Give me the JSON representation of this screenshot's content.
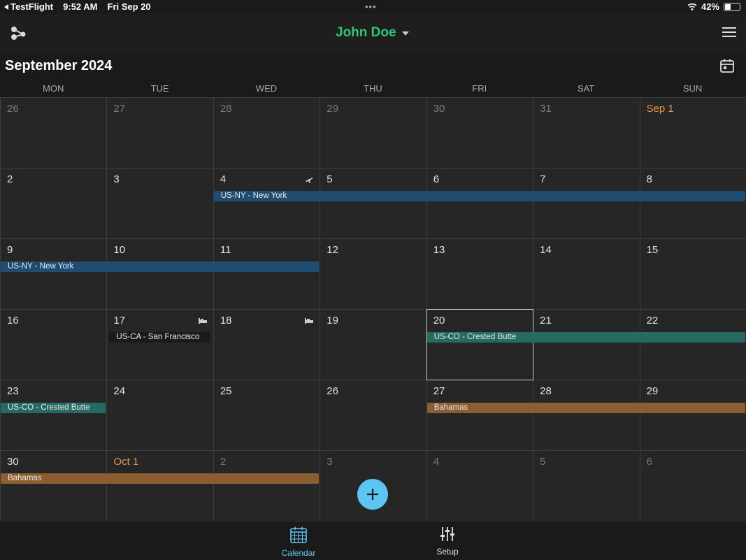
{
  "status_bar": {
    "back_app": "TestFlight",
    "time": "9:52 AM",
    "date": "Fri Sep 20",
    "dots": "•••",
    "battery": "42%",
    "battery_level": 0.42
  },
  "header": {
    "user": "John Doe",
    "title_color": "#2fc57b"
  },
  "calendar": {
    "month_title": "September 2024",
    "weekdays": [
      "MON",
      "TUE",
      "WED",
      "THU",
      "FRI",
      "SAT",
      "SUN"
    ],
    "weeks": [
      [
        "26",
        "27",
        "28",
        "29",
        "30",
        "31",
        "Sep 1"
      ],
      [
        "2",
        "3",
        "4",
        "5",
        "6",
        "7",
        "8"
      ],
      [
        "9",
        "10",
        "11",
        "12",
        "13",
        "14",
        "15"
      ],
      [
        "16",
        "17",
        "18",
        "19",
        "20",
        "21",
        "22"
      ],
      [
        "23",
        "24",
        "25",
        "26",
        "27",
        "28",
        "29"
      ],
      [
        "30",
        "Oct 1",
        "2",
        "3",
        "4",
        "5",
        "6"
      ]
    ],
    "today": "20",
    "events": [
      {
        "label": "US-NY - New York",
        "color": "#1f4d72"
      },
      {
        "label": "US-NY - New York",
        "color": "#1f4d72"
      },
      {
        "label": "US-CA - San Francisco",
        "color": "#1b1b1b"
      },
      {
        "label": "US-CO - Crested Butte",
        "color": "#256b61"
      },
      {
        "label": "US-CO - Crested Butte",
        "color": "#256b61"
      },
      {
        "label": "Bahamas",
        "color": "#8a5e30"
      },
      {
        "label": "Bahamas",
        "color": "#8a5e30"
      }
    ],
    "day_icons": {
      "travel": "airplane-icon",
      "lodging": "bed-icon"
    }
  },
  "colors": {
    "accent": "#5cc6f2",
    "month_start": "#e8954a"
  },
  "tabs": [
    {
      "label": "Calendar",
      "icon": "calendar-grid-icon",
      "active": true
    },
    {
      "label": "Setup",
      "icon": "sliders-icon",
      "active": false
    }
  ]
}
